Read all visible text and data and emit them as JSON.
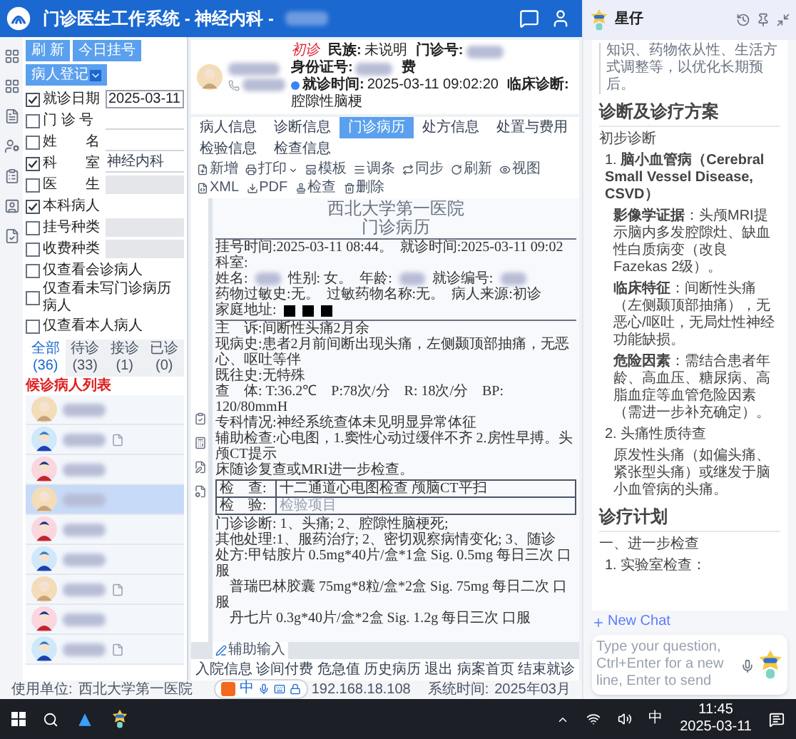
{
  "app": {
    "title": "门诊医生工作系统 - 神经内科 -"
  },
  "left_panel": {
    "buttons": [
      {
        "label": "刷 新",
        "kind": "plain"
      },
      {
        "label": "今日挂号",
        "kind": "plain"
      },
      {
        "label": "病人登记",
        "kind": "dropdown"
      }
    ],
    "filters": [
      {
        "label": "就诊日期",
        "checked": true,
        "kind": "date",
        "value": "2025-03-11"
      },
      {
        "label": "门 诊 号",
        "checked": false,
        "kind": "text"
      },
      {
        "label": "姓　　名",
        "checked": false,
        "kind": "text"
      },
      {
        "label": "科　　室",
        "checked": true,
        "kind": "text",
        "value": "神经内科"
      },
      {
        "label": "医　　生",
        "checked": false,
        "kind": "select"
      },
      {
        "label": "本科病人",
        "checked": true,
        "kind": "none"
      },
      {
        "label": "挂号种类",
        "checked": false,
        "kind": "select"
      },
      {
        "label": "收费种类",
        "checked": false,
        "kind": "select"
      },
      {
        "label": "仅查看会诊病人",
        "checked": false,
        "kind": "none"
      },
      {
        "label": "仅查看未写门诊病历病人",
        "checked": false,
        "kind": "none"
      },
      {
        "label": "仅查看本人病人",
        "checked": false,
        "kind": "none"
      }
    ],
    "tabs": [
      {
        "label": "全部",
        "count": "(36)",
        "selected": true
      },
      {
        "label": "待诊",
        "count": "(33)",
        "selected": false
      },
      {
        "label": "接诊",
        "count": "(1)",
        "selected": false
      },
      {
        "label": "已诊",
        "count": "(0)",
        "selected": false
      }
    ],
    "list_title": "候诊病人列表",
    "patients": [
      {
        "kind": "elder",
        "selected": false,
        "has_record": false
      },
      {
        "kind": "male",
        "selected": false,
        "has_record": true
      },
      {
        "kind": "female",
        "selected": false,
        "has_record": false
      },
      {
        "kind": "elder",
        "selected": true,
        "has_record": false
      },
      {
        "kind": "female",
        "selected": false,
        "has_record": false
      },
      {
        "kind": "male",
        "selected": false,
        "has_record": false
      },
      {
        "kind": "elder",
        "selected": false,
        "has_record": true
      },
      {
        "kind": "female",
        "selected": false,
        "has_record": false
      },
      {
        "kind": "male",
        "selected": false,
        "has_record": true
      }
    ]
  },
  "patient": {
    "visit_type": "初诊",
    "fields": [
      {
        "label": "民族:",
        "value": "未说明"
      },
      {
        "label": "门诊号:"
      },
      {
        "label": "身份证号:"
      }
    ],
    "fee": "费",
    "visit_time": {
      "label": "就诊时间:",
      "value": "2025-03-11 09:02:20"
    },
    "diagnosis": {
      "label": "临床诊断:",
      "value": "腔隙性脑梗"
    }
  },
  "record_tabs": [
    {
      "label": "病人信息",
      "selected": false
    },
    {
      "label": "诊断信息",
      "selected": false
    },
    {
      "label": "门诊病历",
      "selected": true
    },
    {
      "label": "处方信息",
      "selected": false
    },
    {
      "label": "处置与费用",
      "selected": false
    },
    {
      "label": "检验信息",
      "selected": false
    },
    {
      "label": "检查信息",
      "selected": false
    }
  ],
  "toolbar": [
    {
      "label": "新增",
      "kind": "new"
    },
    {
      "label": "打印",
      "kind": "print"
    },
    {
      "label": "模板",
      "kind": "template"
    },
    {
      "label": "调条",
      "kind": "list"
    },
    {
      "label": "同步",
      "kind": "sync"
    },
    {
      "label": "刷新",
      "kind": "refresh"
    },
    {
      "label": "视图",
      "kind": "view"
    },
    {
      "label": "XML",
      "kind": "xml"
    },
    {
      "label": "PDF",
      "kind": "pdf"
    },
    {
      "label": "检查",
      "kind": "check"
    },
    {
      "label": "删除",
      "kind": "delete"
    }
  ],
  "document": {
    "hospital": "西北大学第一医院",
    "title": "门诊病历",
    "header_rows": [
      [
        {
          "kind": "text",
          "text": "挂号时间:2025-03-11 08:44。"
        },
        {
          "kind": "text",
          "text": "就诊时间:2025-03-11 09:02"
        },
        {
          "kind": "text",
          "text": "科室:"
        }
      ],
      [
        {
          "kind": "text",
          "text": "姓名:"
        },
        {
          "kind": "blur"
        },
        {
          "kind": "text",
          "text": "性别: 女。"
        },
        {
          "kind": "text",
          "text": "年龄:"
        },
        {
          "kind": "blur"
        },
        {
          "kind": "text",
          "text": "就诊编号:"
        },
        {
          "kind": "blur"
        }
      ],
      [
        {
          "kind": "text",
          "text": "药物过敏史:无。"
        },
        {
          "kind": "text",
          "text": "过敏药物名称:无。"
        },
        {
          "kind": "text",
          "text": "病人来源:初诊"
        }
      ],
      [
        {
          "kind": "text",
          "text": "家庭地址:"
        },
        {
          "kind": "redacted"
        },
        {
          "kind": "redacted"
        },
        {
          "kind": "redacted"
        }
      ]
    ],
    "body": [
      "主　诉:间断性头痛2月余",
      "现病史:患者2月前间断出现头痛，左侧颞顶部抽痛，无恶心、呕吐等伴",
      "既往史:无特殊",
      "查　体: T:36.2℃　P:78次/分　R: 18次/分　BP: 120/80mmH",
      "专科情况:神经系统查体未见明显异常体征",
      "辅助检查:心电图，1.窦性心动过缓伴不齐 2.房性早搏。头颅CT提示",
      "床随诊复查或MRI进一步检查。"
    ],
    "exam_table": [
      {
        "label": "检　查:",
        "value": "十二通道心电图检查 颅脑CT平扫"
      },
      {
        "label": "检　验:",
        "placeholder": "检验项目"
      }
    ],
    "after": [
      "门诊诊断: 1、头痛; 2、腔隙性脑梗死;",
      "其他处理:1、服药治疗; 2、密切观察病情变化; 3、随诊",
      "处方:甲钴胺片 0.5mg*40片/盒*1盒 Sig. 0.5mg 每日三次 口服",
      "　普瑞巴林胶囊 75mg*8粒/盒*2盒 Sig. 75mg 每日二次 口服",
      "　丹七片 0.3g*40片/盒*2盒 Sig. 1.2g 每日三次 口服"
    ],
    "assist_button": "辅助输入"
  },
  "bottom_buttons": [
    "入院信息",
    "诊间付费",
    "危急值",
    "历史病历",
    "退出",
    "病案首页",
    "结束就诊"
  ],
  "status_bar": {
    "unit_label": "使用单位:",
    "unit": "西北大学第一医院",
    "ip": "192.168.18.108",
    "time_label": "系统时间:",
    "time": "2025年03月"
  },
  "ime": {
    "label": "中"
  },
  "assistant": {
    "name": "星仔",
    "blocks": [
      {
        "kind": "paragraph",
        "text": "知识、药物依从性、生活方式调整等，以优化长期预后。"
      },
      {
        "kind": "heading",
        "text": "诊断及诊疗方案"
      },
      {
        "kind": "label",
        "text": "初步诊断"
      },
      {
        "kind": "item",
        "text": "1. **脑小血管病（Cerebral Small Vessel Disease, CSVD）**"
      },
      {
        "kind": "detail",
        "text": "**影像学证据**：头颅MRI提示脑内多发腔隙灶、缺血性白质病变（改良Fazekas 2级）。"
      },
      {
        "kind": "detail",
        "text": "**临床特征**：间断性头痛（左侧颞顶部抽痛），无恶心/呕吐，无局灶性神经功能缺损。"
      },
      {
        "kind": "detail",
        "text": "**危险因素**：需结合患者年龄、高血压、糖尿病、高脂血症等血管危险因素（需进一步补充确定）。"
      },
      {
        "kind": "item",
        "text": "2. 头痛性质待查"
      },
      {
        "kind": "detail",
        "text": "原发性头痛（如偏头痛、紧张型头痛）或继发于脑小血管病的头痛。"
      },
      {
        "kind": "heading",
        "text": "诊疗计划"
      },
      {
        "kind": "label",
        "text": "一、进一步检查"
      },
      {
        "kind": "item",
        "text": "1. 实验室检查："
      }
    ],
    "new_chat": "New Chat",
    "input": {
      "placeholder": "Type your question, Ctrl+Enter for a new line, Enter to send"
    }
  },
  "taskbar": {
    "ime": "中",
    "time": "11:45",
    "date": "2025-03-11"
  }
}
